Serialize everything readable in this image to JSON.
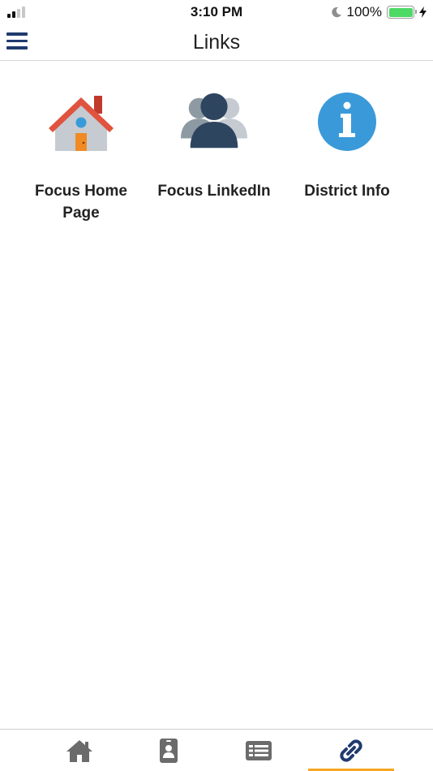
{
  "status_bar": {
    "time": "3:10 PM",
    "battery_percent": "100%",
    "signal_bars_on": 2,
    "signal_bars_total": 4
  },
  "nav": {
    "title": "Links",
    "menu_icon": "hamburger-menu-icon"
  },
  "links": [
    {
      "label": "Focus Home Page",
      "icon": "house-icon"
    },
    {
      "label": "Focus LinkedIn",
      "icon": "people-icon"
    },
    {
      "label": "District Info",
      "icon": "info-icon"
    }
  ],
  "tabs": [
    {
      "icon": "home-icon",
      "active": false
    },
    {
      "icon": "contact-card-icon",
      "active": false
    },
    {
      "icon": "news-list-icon",
      "active": false
    },
    {
      "icon": "link-icon",
      "active": true
    }
  ],
  "colors": {
    "nav_accent": "#1f3a6e",
    "active_tab_indicator": "#f5a623",
    "tab_icon_inactive": "#6b6b6b",
    "tab_icon_active": "#1f3a6e",
    "battery_fill": "#4cd964",
    "info_icon_blue": "#3a9ad9",
    "house_roof_red": "#e0533f",
    "people_dark": "#2e4560"
  }
}
